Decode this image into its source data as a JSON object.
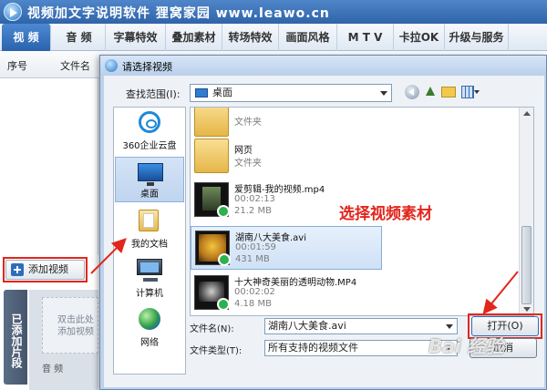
{
  "app": {
    "title": "视频加文字说明软件 狸窝家园 www.leawo.cn"
  },
  "menu": [
    {
      "label": "视 频",
      "active": true
    },
    {
      "label": "音 频"
    },
    {
      "label": "字幕特效"
    },
    {
      "label": "叠加素材"
    },
    {
      "label": "转场特效"
    },
    {
      "label": "画面风格"
    },
    {
      "label": "M T V"
    },
    {
      "label": "卡拉OK"
    },
    {
      "label": "升级与服务"
    }
  ],
  "list_header": {
    "col_index": "序号",
    "col_filename": "文件名"
  },
  "left_panel": {
    "add_video_button": "添加视频",
    "added_tab": "已添加片段",
    "drop_hint_line1": "双击此处",
    "drop_hint_line2": "添加视频",
    "audio_label": "音 频"
  },
  "dialog": {
    "title": "请选择视频",
    "look_in_label": "查找范围(I):",
    "look_in_value": "桌面",
    "places": [
      {
        "label": "360企业云盘",
        "icon": "cloud-icon"
      },
      {
        "label": "桌面",
        "icon": "desktop-icon",
        "selected": true
      },
      {
        "label": "我的文档",
        "icon": "documents-icon"
      },
      {
        "label": "计算机",
        "icon": "computer-icon"
      },
      {
        "label": "网络",
        "icon": "network-icon"
      }
    ],
    "files": [
      {
        "name": "",
        "meta1": "文件夹",
        "meta2": "",
        "kind": "folder"
      },
      {
        "name": "网页",
        "meta1": "文件夹",
        "meta2": "",
        "kind": "folder"
      },
      {
        "name": "爱剪辑-我的视频.mp4",
        "meta1": "00:02:13",
        "meta2": "21.2 MB",
        "kind": "video"
      },
      {
        "name": "湖南八大美食.avi",
        "meta1": "00:01:59",
        "meta2": "431 MB",
        "kind": "video",
        "selected": true
      },
      {
        "name": "十大神奇美丽的透明动物.MP4",
        "meta1": "00:02:02",
        "meta2": "4.18 MB",
        "kind": "video"
      }
    ],
    "file_name_label": "文件名(N):",
    "file_name_value": "湖南八大美食.avi",
    "file_type_label": "文件类型(T):",
    "file_type_value": "所有支持的视频文件",
    "open_button": "打开(O)",
    "cancel_button": "取消"
  },
  "annotation": "选择视频素材",
  "watermark": "Bai 经验",
  "colors": {
    "accent": "#2f64a8",
    "annotation_red": "#e2261b"
  }
}
